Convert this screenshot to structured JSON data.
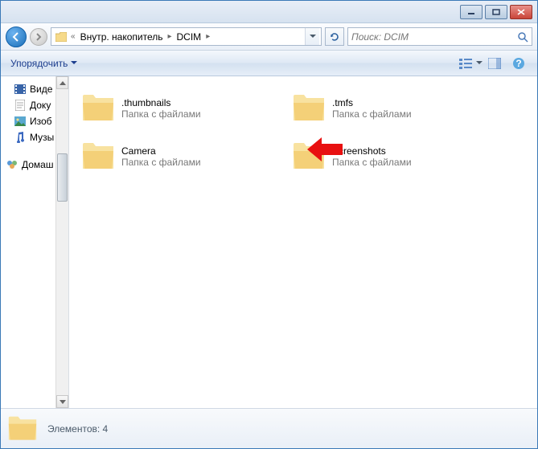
{
  "breadcrumb": {
    "seg1": "Внутр. накопитель",
    "seg2": "DCIM"
  },
  "search": {
    "placeholder": "Поиск: DCIM"
  },
  "toolbar": {
    "organize": "Упорядочить"
  },
  "sidebar": {
    "items": [
      {
        "label": "Виде"
      },
      {
        "label": "Доку"
      },
      {
        "label": "Изоб"
      },
      {
        "label": "Музы"
      }
    ],
    "group": {
      "label": "Домаш"
    }
  },
  "folders": [
    {
      "name": ".thumbnails",
      "sub": "Папка с файлами"
    },
    {
      "name": ".tmfs",
      "sub": "Папка с файлами"
    },
    {
      "name": "Camera",
      "sub": "Папка с файлами"
    },
    {
      "name": "Screenshots",
      "sub": "Папка с файлами"
    }
  ],
  "status": {
    "text": "Элементов: 4"
  }
}
